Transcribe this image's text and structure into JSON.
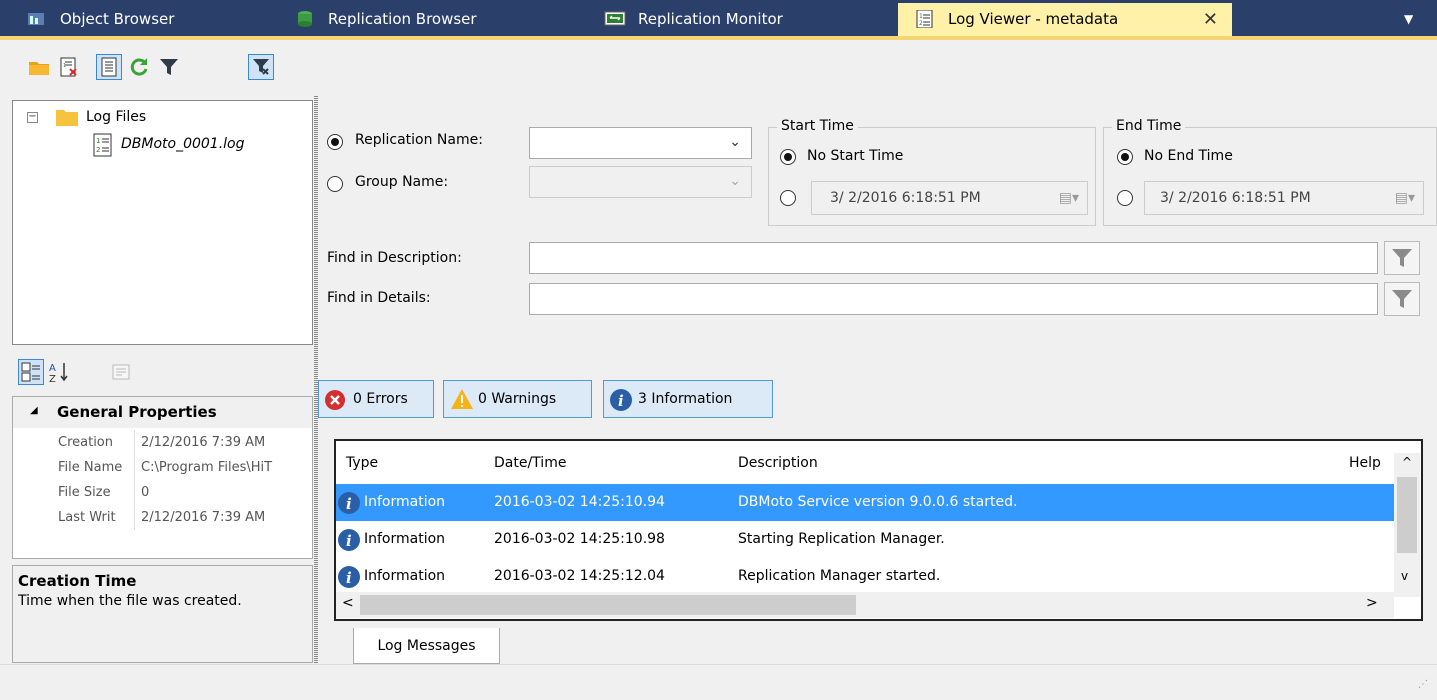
{
  "tabs": [
    {
      "label": "Object Browser",
      "icon": "object-browser-icon"
    },
    {
      "label": "Replication Browser",
      "icon": "replication-browser-icon"
    },
    {
      "label": "Replication Monitor",
      "icon": "replication-monitor-icon"
    },
    {
      "label": "Log Viewer - metadata",
      "icon": "log-viewer-icon",
      "active": true
    }
  ],
  "tab_close": "✕",
  "toolbar": [
    "open-folder-icon",
    "clear-log-icon",
    "log-view-icon",
    "refresh-icon",
    "filter-icon",
    "clear-filter-icon"
  ],
  "tree": {
    "root": "Log Files",
    "file": "DBMoto_0001.log"
  },
  "properties": {
    "section": "General Properties",
    "rows": [
      {
        "key": "Creation",
        "value": "2/12/2016 7:39 AM"
      },
      {
        "key": "File Name",
        "value": "C:\\Program Files\\HiT"
      },
      {
        "key": "File Size",
        "value": "0"
      },
      {
        "key": "Last Writ",
        "value": "2/12/2016 7:39 AM"
      }
    ],
    "help_title": "Creation Time",
    "help_text": "Time when the file was created."
  },
  "filter": {
    "replication_name_label": "Replication Name:",
    "group_name_label": "Group Name:",
    "start_time": {
      "title": "Start Time",
      "none": "No Start Time",
      "value": "3/ 2/2016   6:18:51 PM"
    },
    "end_time": {
      "title": "End Time",
      "none": "No End Time",
      "value": "3/ 2/2016   6:18:51 PM"
    },
    "find_description_label": "Find in Description:",
    "find_details_label": "Find in Details:"
  },
  "counters": {
    "errors": "0 Errors",
    "warnings": "0 Warnings",
    "information": "3 Information"
  },
  "grid": {
    "columns": [
      "Type",
      "Date/Time",
      "Description",
      "Help"
    ],
    "rows": [
      {
        "type": "Information",
        "datetime": "2016-03-02 14:25:10.94",
        "description": "DBMoto Service version 9.0.0.6 started."
      },
      {
        "type": "Information",
        "datetime": "2016-03-02 14:25:10.98",
        "description": "Starting Replication Manager."
      },
      {
        "type": "Information",
        "datetime": "2016-03-02 14:25:12.04",
        "description": "Replication Manager started."
      }
    ]
  },
  "bottom_tab": "Log Messages",
  "colors": {
    "tabbar": "#2b3f6b",
    "active_tab": "#fff1a8",
    "selection": "#3399ff"
  }
}
